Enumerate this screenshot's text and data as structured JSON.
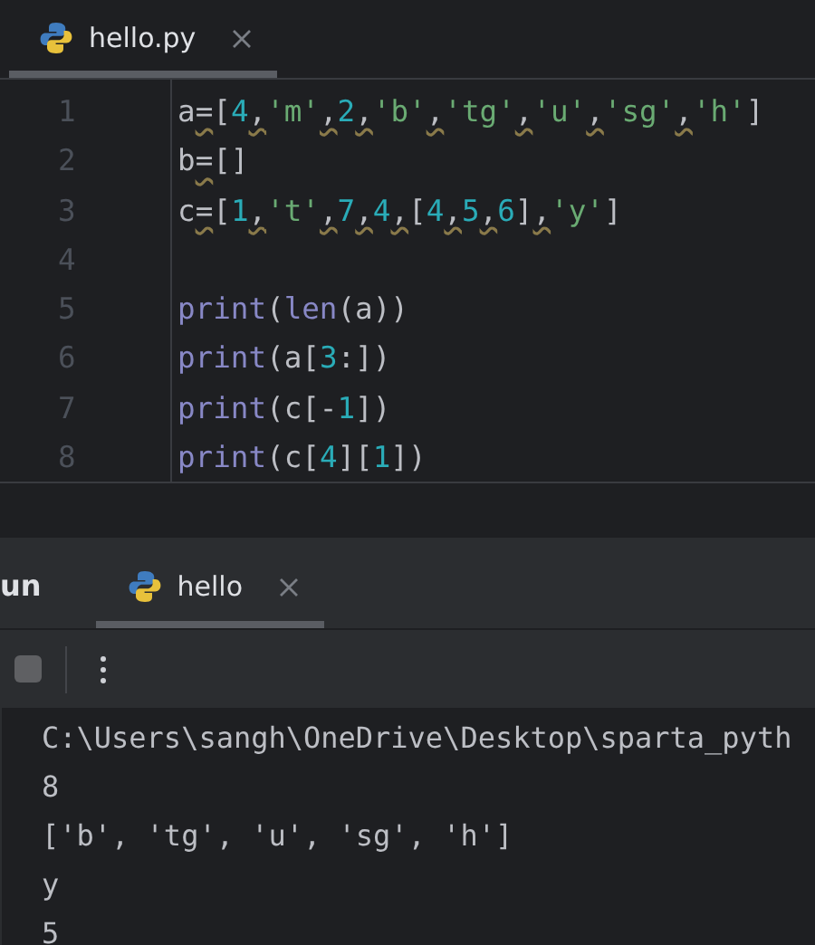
{
  "editor_tabs": [
    {
      "label": "hello.py",
      "selected": true
    }
  ],
  "code_lines": [
    {
      "number": "1",
      "tokens": [
        {
          "text": "a",
          "kind": "ident"
        },
        {
          "text": "=",
          "kind": "warn"
        },
        {
          "text": "[",
          "kind": "punct"
        },
        {
          "text": "4",
          "kind": "num"
        },
        {
          "text": ",",
          "kind": "warn"
        },
        {
          "text": "'m'",
          "kind": "str"
        },
        {
          "text": ",",
          "kind": "warn"
        },
        {
          "text": "2",
          "kind": "num"
        },
        {
          "text": ",",
          "kind": "warn"
        },
        {
          "text": "'b'",
          "kind": "str"
        },
        {
          "text": ",",
          "kind": "warn"
        },
        {
          "text": "'tg'",
          "kind": "str"
        },
        {
          "text": ",",
          "kind": "warn"
        },
        {
          "text": "'u'",
          "kind": "str"
        },
        {
          "text": ",",
          "kind": "warn"
        },
        {
          "text": "'sg'",
          "kind": "str"
        },
        {
          "text": ",",
          "kind": "warn"
        },
        {
          "text": "'h'",
          "kind": "str"
        },
        {
          "text": "]",
          "kind": "punct"
        }
      ]
    },
    {
      "number": "2",
      "tokens": [
        {
          "text": "b",
          "kind": "ident"
        },
        {
          "text": "=",
          "kind": "warn"
        },
        {
          "text": "[]",
          "kind": "punct"
        }
      ]
    },
    {
      "number": "3",
      "tokens": [
        {
          "text": "c",
          "kind": "ident"
        },
        {
          "text": "=",
          "kind": "warn"
        },
        {
          "text": "[",
          "kind": "punct"
        },
        {
          "text": "1",
          "kind": "num"
        },
        {
          "text": ",",
          "kind": "warn"
        },
        {
          "text": "'t'",
          "kind": "str"
        },
        {
          "text": ",",
          "kind": "warn"
        },
        {
          "text": "7",
          "kind": "num"
        },
        {
          "text": ",",
          "kind": "warn"
        },
        {
          "text": "4",
          "kind": "num"
        },
        {
          "text": ",",
          "kind": "warn"
        },
        {
          "text": "[",
          "kind": "punct"
        },
        {
          "text": "4",
          "kind": "num"
        },
        {
          "text": ",",
          "kind": "warn"
        },
        {
          "text": "5",
          "kind": "num"
        },
        {
          "text": ",",
          "kind": "warn"
        },
        {
          "text": "6",
          "kind": "num"
        },
        {
          "text": "]",
          "kind": "punct"
        },
        {
          "text": ",",
          "kind": "warn"
        },
        {
          "text": "'y'",
          "kind": "str"
        },
        {
          "text": "]",
          "kind": "punct"
        }
      ]
    },
    {
      "number": "4"
    },
    {
      "number": "5",
      "tokens": [
        {
          "text": "print",
          "kind": "builtin"
        },
        {
          "text": "(",
          "kind": "punct"
        },
        {
          "text": "len",
          "kind": "builtin"
        },
        {
          "text": "(a))",
          "kind": "punct"
        }
      ]
    },
    {
      "number": "6",
      "tokens": [
        {
          "text": "print",
          "kind": "builtin"
        },
        {
          "text": "(a[",
          "kind": "punct"
        },
        {
          "text": "3",
          "kind": "num"
        },
        {
          "text": ":])",
          "kind": "punct"
        }
      ]
    },
    {
      "number": "7",
      "tokens": [
        {
          "text": "print",
          "kind": "builtin"
        },
        {
          "text": "(c[-",
          "kind": "punct"
        },
        {
          "text": "1",
          "kind": "num"
        },
        {
          "text": "])",
          "kind": "punct"
        }
      ]
    },
    {
      "number": "8",
      "tokens": [
        {
          "text": "print",
          "kind": "builtin"
        },
        {
          "text": "(c[",
          "kind": "punct"
        },
        {
          "text": "4",
          "kind": "num"
        },
        {
          "text": "][",
          "kind": "punct"
        },
        {
          "text": "1",
          "kind": "num"
        },
        {
          "text": "])",
          "kind": "punct"
        }
      ]
    }
  ],
  "run_panel": {
    "title": "un",
    "tabs": [
      {
        "label": "hello",
        "selected": true
      }
    ]
  },
  "console_lines": [
    "C:\\Users\\sangh\\OneDrive\\Desktop\\sparta_pyth",
    "8",
    "['b', 'tg', 'u', 'sg', 'h']",
    "y",
    "5"
  ]
}
